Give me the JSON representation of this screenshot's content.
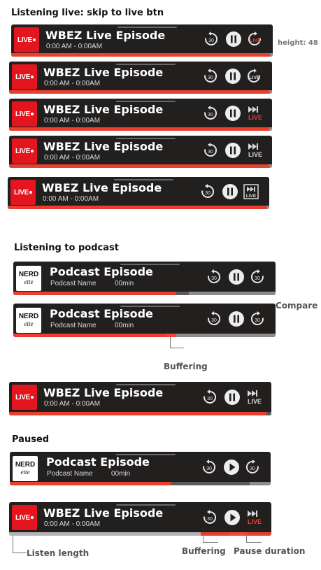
{
  "headings": {
    "live": "Listening live: skip to live btn",
    "podcast": "Listening to podcast",
    "paused": "Paused"
  },
  "notes": {
    "height": "height: 48",
    "compare": "Compare",
    "buffering": "Buffering",
    "buffering2": "Buffering",
    "pause_duration": "Pause duration",
    "listen_length": "Listen length"
  },
  "live_episode": {
    "logo_text": "LIVE",
    "title": "WBEZ Live Episode",
    "time": "0:00 AM - 0:00AM"
  },
  "podcast_episode": {
    "logo_line1": "NERD",
    "logo_line2": "ette",
    "title": "Podcast Episode",
    "show": "Podcast Name",
    "duration": "00min"
  },
  "controls": {
    "rewind_label": "30",
    "forward_label": "30",
    "live_label": "LIVE",
    "icons": [
      "rewind-30-icon",
      "pause-icon",
      "play-icon",
      "forward-30-icon",
      "skip-to-live-icon"
    ]
  },
  "colors": {
    "player_bg": "#221f1f",
    "accent_red": "#e4151f",
    "progress_red": "#e8402e",
    "track_gray": "#8f8b8b",
    "buffer_gray": "#5c5959"
  },
  "progress": {
    "live_variants": 0.99,
    "podcast_1": {
      "played": 0.62,
      "buffered": 0.67
    },
    "podcast_2": {
      "played": 0.58,
      "buffered": 0.62
    },
    "live_6": 0.98,
    "paused_podcast": {
      "played": 0.62,
      "buffered": 0.92
    },
    "paused_live": {
      "listened": 0.0,
      "played": 0.73,
      "buffered": 0.84,
      "paused": 0.91
    }
  }
}
